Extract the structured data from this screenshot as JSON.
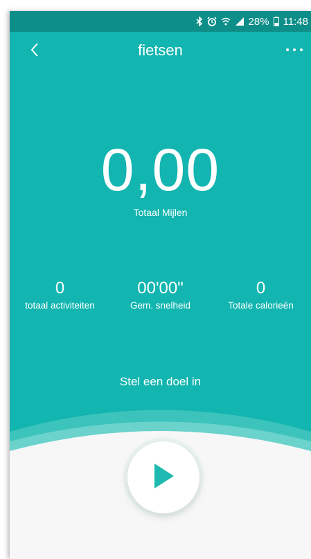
{
  "status_bar": {
    "battery": "28%",
    "time": "11:48",
    "icons": [
      "bluetooth-icon",
      "alarm-icon",
      "wifi-icon",
      "signal-icon",
      "battery-icon"
    ]
  },
  "app_bar": {
    "title": "fietsen",
    "back_icon": "chevron-left-icon",
    "more_icon": "more-horizontal-icon"
  },
  "summary": {
    "total_value": "0,00",
    "total_label": "Totaal Mijlen"
  },
  "stats": [
    {
      "value": "0",
      "label": "totaal activiteiten"
    },
    {
      "value": "00'00\"",
      "label": "Gem. snelheid"
    },
    {
      "value": "0",
      "label": "Totale calorieën"
    }
  ],
  "goal_label": "Stel een doel in",
  "play_icon": "play-icon",
  "colors": {
    "primary": "#12B5B0",
    "status_bar": "#0E8E88",
    "bottom_panel": "#F7F7F7",
    "play_triangle": "#1EB9B0"
  }
}
